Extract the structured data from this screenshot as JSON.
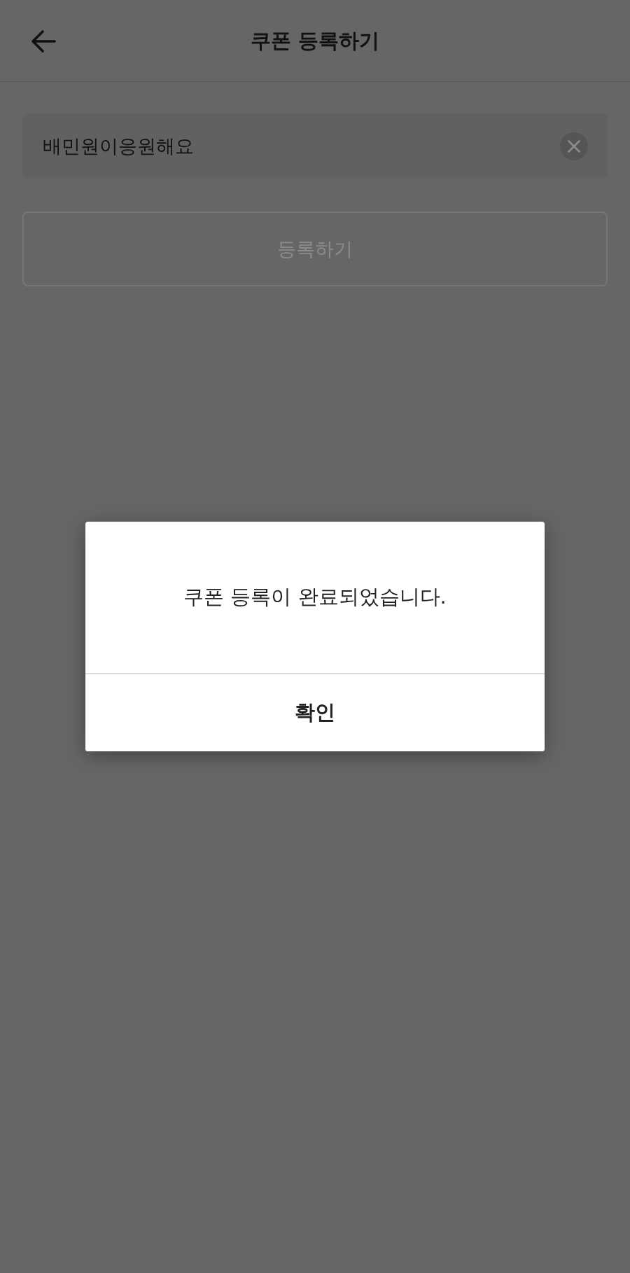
{
  "header": {
    "title": "쿠폰 등록하기"
  },
  "coupon_field": {
    "value": "배민원이응원해요"
  },
  "register_button": {
    "label": "등록하기",
    "disabled": true
  },
  "dialog": {
    "message": "쿠폰 등록이 완료되었습니다.",
    "buttons": [
      {
        "label": "확인"
      }
    ]
  }
}
